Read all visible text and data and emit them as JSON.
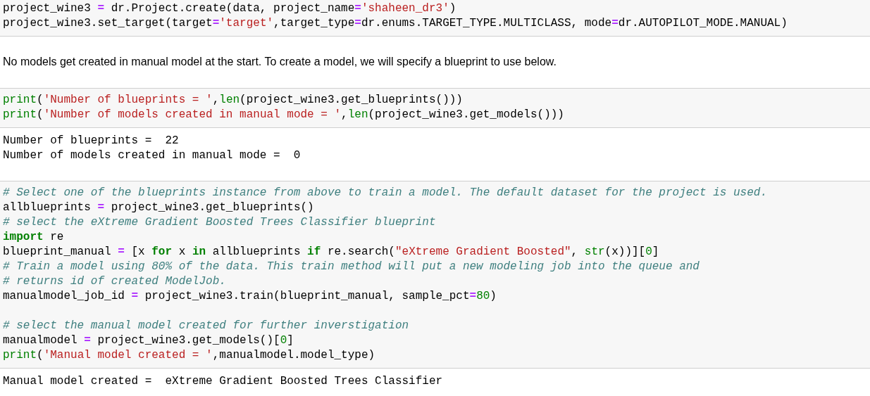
{
  "cells": [
    {
      "kind": "code",
      "lines": [
        {
          "tokens": [
            {
              "kind": "t",
              "text": "project_wine3 "
            },
            {
              "kind": "o",
              "text": "="
            },
            {
              "kind": "t",
              "text": " dr.Project.create(data, project_name"
            },
            {
              "kind": "o",
              "text": "="
            },
            {
              "kind": "s",
              "text": "'shaheen_dr3'"
            },
            {
              "kind": "t",
              "text": ")"
            }
          ]
        },
        {
          "tokens": [
            {
              "kind": "t",
              "text": "project_wine3.set_target(target"
            },
            {
              "kind": "o",
              "text": "="
            },
            {
              "kind": "s",
              "text": "'target'"
            },
            {
              "kind": "t",
              "text": ",target_type"
            },
            {
              "kind": "o",
              "text": "="
            },
            {
              "kind": "t",
              "text": "dr.enums.TARGET_TYPE.MULTICLASS, mode"
            },
            {
              "kind": "o",
              "text": "="
            },
            {
              "kind": "t",
              "text": "dr.AUTOPILOT_MODE.MANUAL)"
            }
          ]
        }
      ]
    },
    {
      "kind": "markdown",
      "text": "No models get created in manual model at the start. To create a model, we will specify a blueprint to use below."
    },
    {
      "kind": "code",
      "lines": [
        {
          "tokens": [
            {
              "kind": "b",
              "text": "print"
            },
            {
              "kind": "t",
              "text": "("
            },
            {
              "kind": "s",
              "text": "'Number of blueprints = '"
            },
            {
              "kind": "t",
              "text": ","
            },
            {
              "kind": "b",
              "text": "len"
            },
            {
              "kind": "t",
              "text": "(project_wine3.get_blueprints()))"
            }
          ]
        },
        {
          "tokens": [
            {
              "kind": "b",
              "text": "print"
            },
            {
              "kind": "t",
              "text": "("
            },
            {
              "kind": "s",
              "text": "'Number of models created in manual mode = '"
            },
            {
              "kind": "t",
              "text": ","
            },
            {
              "kind": "b",
              "text": "len"
            },
            {
              "kind": "t",
              "text": "(project_wine3.get_models()))"
            }
          ]
        }
      ]
    },
    {
      "kind": "output",
      "lines": [
        "Number of blueprints =  22",
        "Number of models created in manual mode =  0"
      ]
    },
    {
      "kind": "code",
      "lines": [
        {
          "tokens": [
            {
              "kind": "c",
              "text": "# Select one of the blueprints instance from above to train a model. The default dataset for the project is used."
            }
          ]
        },
        {
          "tokens": [
            {
              "kind": "t",
              "text": "allblueprints "
            },
            {
              "kind": "o",
              "text": "="
            },
            {
              "kind": "t",
              "text": " project_wine3.get_blueprints()"
            }
          ]
        },
        {
          "tokens": [
            {
              "kind": "c",
              "text": "# select the eXtreme Gradient Boosted Trees Classifier blueprint"
            }
          ]
        },
        {
          "tokens": [
            {
              "kind": "k",
              "text": "import"
            },
            {
              "kind": "t",
              "text": " re"
            }
          ]
        },
        {
          "tokens": [
            {
              "kind": "t",
              "text": "blueprint_manual "
            },
            {
              "kind": "o",
              "text": "="
            },
            {
              "kind": "t",
              "text": " [x "
            },
            {
              "kind": "k",
              "text": "for"
            },
            {
              "kind": "t",
              "text": " x "
            },
            {
              "kind": "k",
              "text": "in"
            },
            {
              "kind": "t",
              "text": " allblueprints "
            },
            {
              "kind": "k",
              "text": "if"
            },
            {
              "kind": "t",
              "text": " re.search("
            },
            {
              "kind": "s",
              "text": "\"eXtreme Gradient Boosted\""
            },
            {
              "kind": "t",
              "text": ", "
            },
            {
              "kind": "b",
              "text": "str"
            },
            {
              "kind": "t",
              "text": "(x))]["
            },
            {
              "kind": "n",
              "text": "0"
            },
            {
              "kind": "t",
              "text": "]"
            }
          ]
        },
        {
          "tokens": [
            {
              "kind": "c",
              "text": "# Train a model using 80% of the data. This train method will put a new modeling job into the queue and"
            }
          ]
        },
        {
          "tokens": [
            {
              "kind": "c",
              "text": "# returns id of created ModelJob."
            }
          ]
        },
        {
          "tokens": [
            {
              "kind": "t",
              "text": "manualmodel_job_id "
            },
            {
              "kind": "o",
              "text": "="
            },
            {
              "kind": "t",
              "text": " project_wine3.train(blueprint_manual, sample_pct"
            },
            {
              "kind": "o",
              "text": "="
            },
            {
              "kind": "n",
              "text": "80"
            },
            {
              "kind": "t",
              "text": ")"
            }
          ]
        },
        {
          "blank_before": true,
          "tokens": [
            {
              "kind": "c",
              "text": "# select the manual model created for further inverstigation"
            }
          ]
        },
        {
          "tokens": [
            {
              "kind": "t",
              "text": "manualmodel "
            },
            {
              "kind": "o",
              "text": "="
            },
            {
              "kind": "t",
              "text": " project_wine3.get_models()["
            },
            {
              "kind": "n",
              "text": "0"
            },
            {
              "kind": "t",
              "text": "]"
            }
          ]
        },
        {
          "tokens": [
            {
              "kind": "b",
              "text": "print"
            },
            {
              "kind": "t",
              "text": "("
            },
            {
              "kind": "s",
              "text": "'Manual model created = '"
            },
            {
              "kind": "t",
              "text": ",manualmodel.model_type)"
            }
          ]
        }
      ]
    },
    {
      "kind": "output",
      "lines": [
        "Manual model created =  eXtreme Gradient Boosted Trees Classifier"
      ]
    }
  ]
}
